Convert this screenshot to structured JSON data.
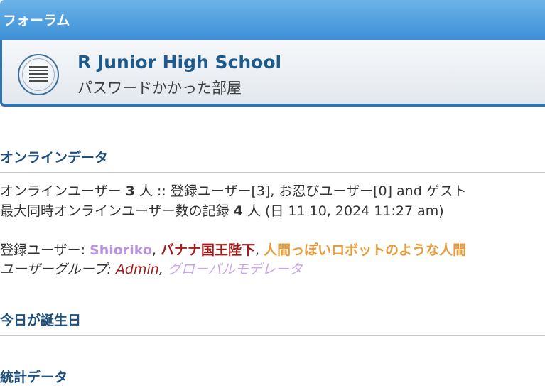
{
  "header": {
    "title": "フォーラム"
  },
  "forum": {
    "name": "R Junior High School",
    "description": "パスワードかかった部屋",
    "icon": "document-lines-icon"
  },
  "online": {
    "heading": "オンラインデータ",
    "line1": {
      "prefix": "オンラインユーザー",
      "count": "3",
      "rest": "人 :: 登録ユーザー[3], お忍びユーザー[0] and ゲスト"
    },
    "line2": {
      "prefix": "最大同時オンラインユーザー数の記録",
      "count": "4",
      "rest": "人 (日 11 10, 2024 11:27 am)"
    },
    "registered_label": "登録ユーザー:",
    "users": [
      "Shioriko",
      "バナナ国王陛下",
      "人間っぽいロボットのような人間"
    ],
    "groups_label": "ユーザーグループ:",
    "groups": [
      "Admin",
      "グローバルモデレータ"
    ],
    "colors": {
      "user1": "#b993e0",
      "user2": "#a21b1b",
      "user3": "#e79a35",
      "group_admin": "#a21b1b",
      "group_global_mod": "#c9a6ea"
    }
  },
  "birthday": {
    "heading": "今日が誕生日"
  },
  "stats": {
    "heading": "統計データ"
  }
}
